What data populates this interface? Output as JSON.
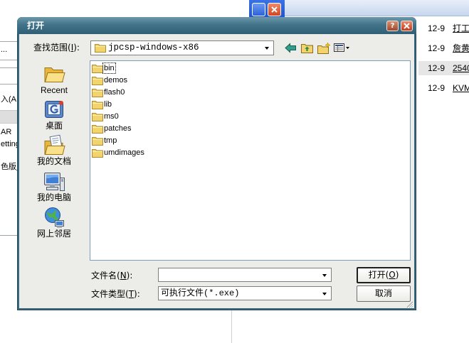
{
  "background_window": {
    "fragments": {
      "dots": "...",
      "input_a": "入(A",
      "item_ar": "AR",
      "item_setting": "etting",
      "item_color": "色版_"
    }
  },
  "side_list": {
    "rows": [
      {
        "date": "12-9",
        "title": "打工",
        "highlighted": false
      },
      {
        "date": "12-9",
        "title": "詹黄",
        "highlighted": false
      },
      {
        "date": "12-9",
        "title": "2540",
        "highlighted": true
      },
      {
        "date": "12-9",
        "title": "KVM",
        "highlighted": false
      }
    ]
  },
  "dialog": {
    "title": "打开",
    "help_label": "?",
    "look_in": {
      "label": "查找范围(I):",
      "value": "jpcsp-windows-x86",
      "icon": "folder-icon"
    },
    "toolbar": [
      "back-arrow-icon",
      "up-folder-icon",
      "new-folder-icon",
      "views-menu-icon"
    ],
    "places": [
      {
        "label": "Recent",
        "icon": "recent-icon"
      },
      {
        "label": "桌面",
        "icon": "desktop-icon"
      },
      {
        "label": "我的文档",
        "icon": "my-documents-icon"
      },
      {
        "label": "我的电脑",
        "icon": "my-computer-icon"
      },
      {
        "label": "网上邻居",
        "icon": "network-places-icon"
      }
    ],
    "files": [
      {
        "name": "bin",
        "icon": "folder-icon",
        "focused": true
      },
      {
        "name": "demos",
        "icon": "folder-icon"
      },
      {
        "name": "flash0",
        "icon": "folder-icon"
      },
      {
        "name": "lib",
        "icon": "folder-icon"
      },
      {
        "name": "ms0",
        "icon": "folder-icon"
      },
      {
        "name": "patches",
        "icon": "folder-icon"
      },
      {
        "name": "tmp",
        "icon": "folder-icon"
      },
      {
        "name": "umdimages",
        "icon": "folder-icon"
      }
    ],
    "file_name": {
      "label": "文件名(N):",
      "value": ""
    },
    "file_type": {
      "label": "文件类型(T):",
      "value": "可执行文件(*.exe)"
    },
    "buttons": {
      "open": "打开(O)",
      "cancel": "取消"
    }
  },
  "colors": {
    "dialog_frame": "#39697f",
    "dialog_body": "#ecece8",
    "list_background": "#ffffff",
    "list_border": "#7f9db9",
    "folder_yellow": "#f3d36b",
    "row_highlight": "#e6e6e6",
    "xp_caption_blue": "#2d62d6",
    "close_red": "#c33b1b"
  }
}
